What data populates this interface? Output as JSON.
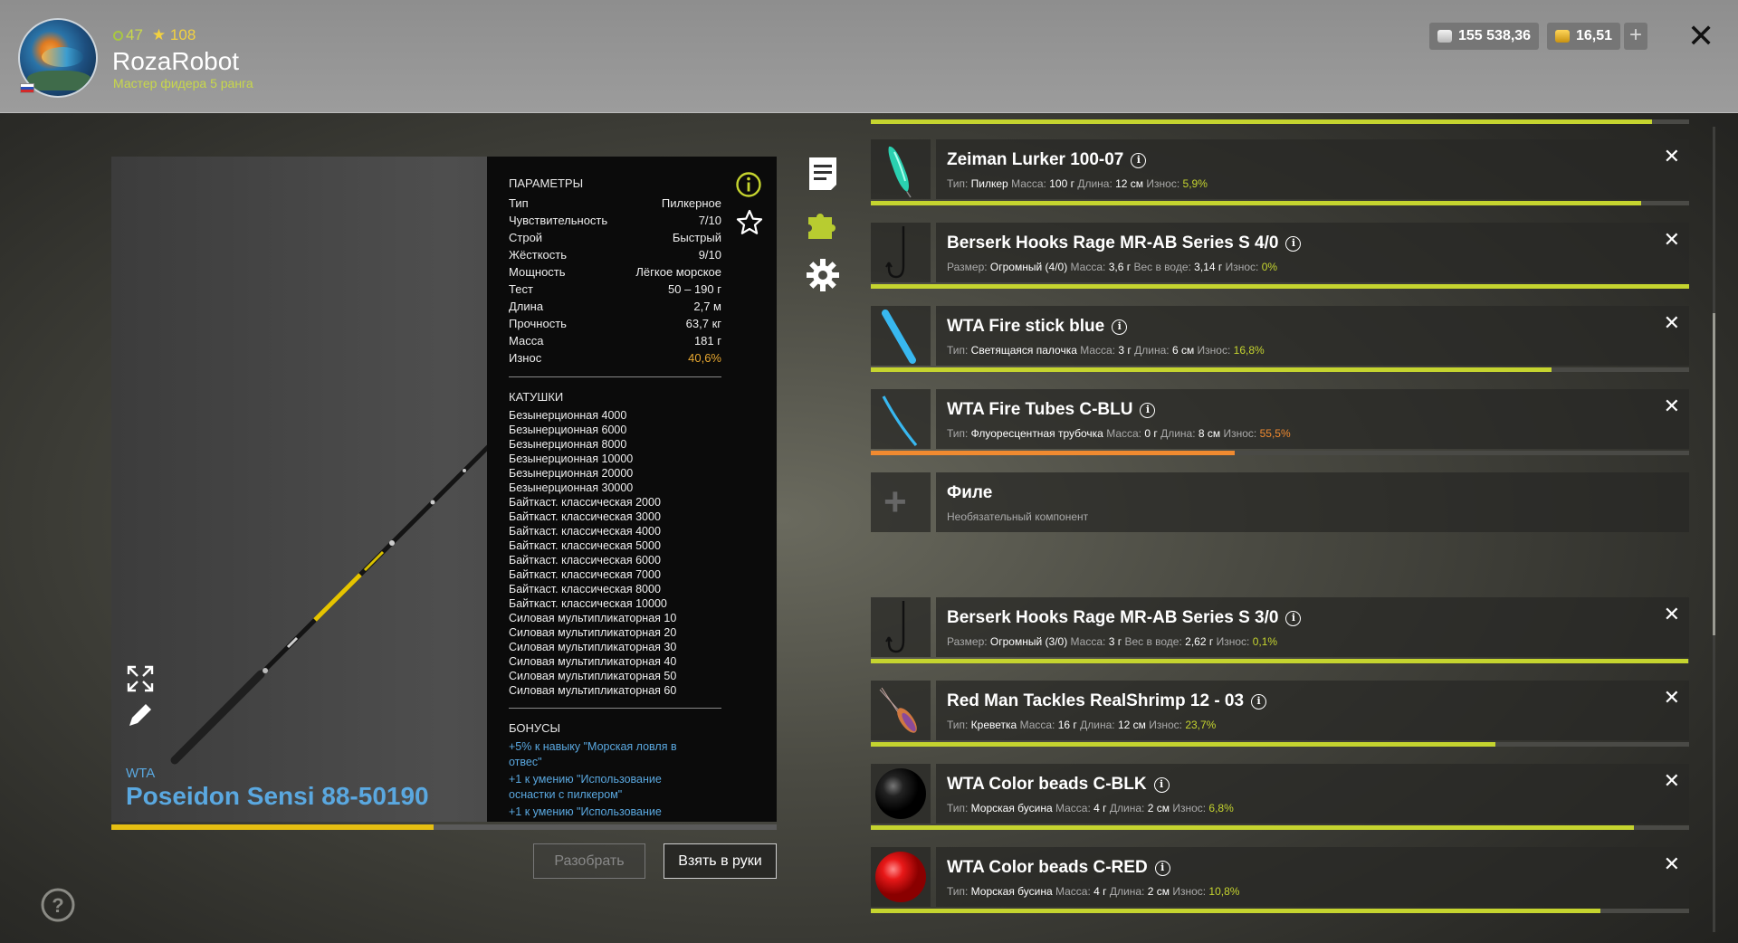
{
  "player": {
    "stat_a": "47",
    "stat_b": "108",
    "name": "RozaRobot",
    "rank": "Мастер фидера 5 ранга"
  },
  "currency": {
    "silver": "155 538,36",
    "gold": "16,51",
    "add_label": "+",
    "close_label": "✕"
  },
  "rod": {
    "brand": "WTA",
    "name": "Poseidon Sensi 88-50190",
    "wear_fraction": 0.485,
    "bar_color": "#e6bf12"
  },
  "params": {
    "title": "ПАРАМЕТРЫ",
    "rows": [
      {
        "k": "Тип",
        "v": "Пилкерное"
      },
      {
        "k": "Чувствительность",
        "v": "7/10"
      },
      {
        "k": "Строй",
        "v": "Быстрый"
      },
      {
        "k": "Жёсткость",
        "v": "9/10"
      },
      {
        "k": "Мощность",
        "v": "Лёгкое морское"
      },
      {
        "k": "Тест",
        "v": "50 – 190 г"
      },
      {
        "k": "Длина",
        "v": "2,7 м"
      },
      {
        "k": "Прочность",
        "v": "63,7 кг"
      },
      {
        "k": "Масса",
        "v": "181 г"
      },
      {
        "k": "Износ",
        "v": "40,6%"
      }
    ],
    "reels_title": "КАТУШКИ",
    "reels": [
      "Безынерционная 4000",
      "Безынерционная 6000",
      "Безынерционная 8000",
      "Безынерционная 10000",
      "Безынерционная 20000",
      "Безынерционная 30000",
      "Байткаст. классическая 2000",
      "Байткаст. классическая 3000",
      "Байткаст. классическая 4000",
      "Байткаст. классическая 5000",
      "Байткаст. классическая 6000",
      "Байткаст. классическая 7000",
      "Байткаст. классическая 8000",
      "Байткаст. классическая 10000",
      "Силовая мультипликаторная 10",
      "Силовая мультипликаторная 20",
      "Силовая мультипликаторная 30",
      "Силовая мультипликаторная 40",
      "Силовая мультипликаторная 50",
      "Силовая мультипликаторная 60"
    ],
    "bonuses_title": "БОНУСЫ",
    "bonuses": [
      "+5% к навыку \"Морская ловля в отвес\"",
      "+1 к умению \"Использование оснастки с пилкером\"",
      "+1 к умению \"Использование"
    ]
  },
  "buttons": {
    "disassemble": "Разобрать",
    "take": "Взять в руки"
  },
  "colors": {
    "accent_green": "#c5d42f",
    "orange": "#f08a30",
    "link_blue": "#5aa8e0"
  },
  "tackle": {
    "top_strip_fraction": 0.955,
    "items": [
      {
        "name": "Zeiman Lurker 100-07",
        "icon": "pilker-lure-icon",
        "details": [
          {
            "l": "Тип:",
            "v": "Пилкер"
          },
          {
            "l": "Масса:",
            "v": "100 г"
          },
          {
            "l": "Длина:",
            "v": "12 см"
          }
        ],
        "wear_label": "Износ:",
        "wear": "5,9%",
        "wear_color": "green",
        "bar": 0.941,
        "bar_color": "#c5d42f",
        "closable": true
      },
      {
        "name": "Berserk Hooks Rage MR-AB Series S 4/0",
        "icon": "hook-icon",
        "details": [
          {
            "l": "Размер:",
            "v": "Огромный (4/0)"
          },
          {
            "l": "Масса:",
            "v": "3,6 г"
          },
          {
            "l": "Вес в воде:",
            "v": "3,14 г"
          }
        ],
        "wear_label": "Износ:",
        "wear": "0%",
        "wear_color": "green",
        "bar": 1.0,
        "bar_color": "#c5d42f",
        "closable": true
      },
      {
        "name": "WTA Fire stick blue",
        "icon": "glow-stick-icon",
        "details": [
          {
            "l": "Тип:",
            "v": "Светящаяся палочка"
          },
          {
            "l": "Масса:",
            "v": "3 г"
          },
          {
            "l": "Длина:",
            "v": "6 см"
          }
        ],
        "wear_label": "Износ:",
        "wear": "16,8%",
        "wear_color": "green",
        "bar": 0.832,
        "bar_color": "#c5d42f",
        "closable": true
      },
      {
        "name": "WTA Fire Tubes C-BLU",
        "icon": "fluorescent-tube-icon",
        "details": [
          {
            "l": "Тип:",
            "v": "Флуоресцентная трубочка"
          },
          {
            "l": "Масса:",
            "v": "0 г"
          },
          {
            "l": "Длина:",
            "v": "8 см"
          }
        ],
        "wear_label": "Износ:",
        "wear": "55,5%",
        "wear_color": "orange",
        "bar": 0.445,
        "bar_color": "#f08a30",
        "closable": true
      },
      {
        "name": "Филе",
        "icon": "add-component-icon",
        "empty": true,
        "subtitle": "Необязательный компонент",
        "closable": false
      },
      {
        "name": "Berserk Hooks Rage MR-AB Series S 3/0",
        "icon": "hook-icon",
        "details": [
          {
            "l": "Размер:",
            "v": "Огромный (3/0)"
          },
          {
            "l": "Масса:",
            "v": "3 г"
          },
          {
            "l": "Вес в воде:",
            "v": "2,62 г"
          }
        ],
        "wear_label": "Износ:",
        "wear": "0,1%",
        "wear_color": "green",
        "bar": 0.999,
        "bar_color": "#c5d42f",
        "closable": true
      },
      {
        "name": "Red Man Tackles RealShrimp 12 - 03",
        "icon": "shrimp-lure-icon",
        "details": [
          {
            "l": "Тип:",
            "v": "Креветка"
          },
          {
            "l": "Масса:",
            "v": "16 г"
          },
          {
            "l": "Длина:",
            "v": "12 см"
          }
        ],
        "wear_label": "Износ:",
        "wear": "23,7%",
        "wear_color": "green",
        "bar": 0.763,
        "bar_color": "#c5d42f",
        "closable": true
      },
      {
        "name": "WTA Color beads C-BLK",
        "icon": "black-bead-icon",
        "details": [
          {
            "l": "Тип:",
            "v": "Морская бусина"
          },
          {
            "l": "Масса:",
            "v": "4 г"
          },
          {
            "l": "Длина:",
            "v": "2 см"
          }
        ],
        "wear_label": "Износ:",
        "wear": "6,8%",
        "wear_color": "green",
        "bar": 0.932,
        "bar_color": "#c5d42f",
        "closable": true
      },
      {
        "name": "WTA Color beads C-RED",
        "icon": "red-bead-icon",
        "details": [
          {
            "l": "Тип:",
            "v": "Морская бусина"
          },
          {
            "l": "Масса:",
            "v": "4 г"
          },
          {
            "l": "Длина:",
            "v": "2 см"
          }
        ],
        "wear_label": "Износ:",
        "wear": "10,8%",
        "wear_color": "green",
        "bar": 0.892,
        "bar_color": "#c5d42f",
        "closable": true
      }
    ]
  }
}
